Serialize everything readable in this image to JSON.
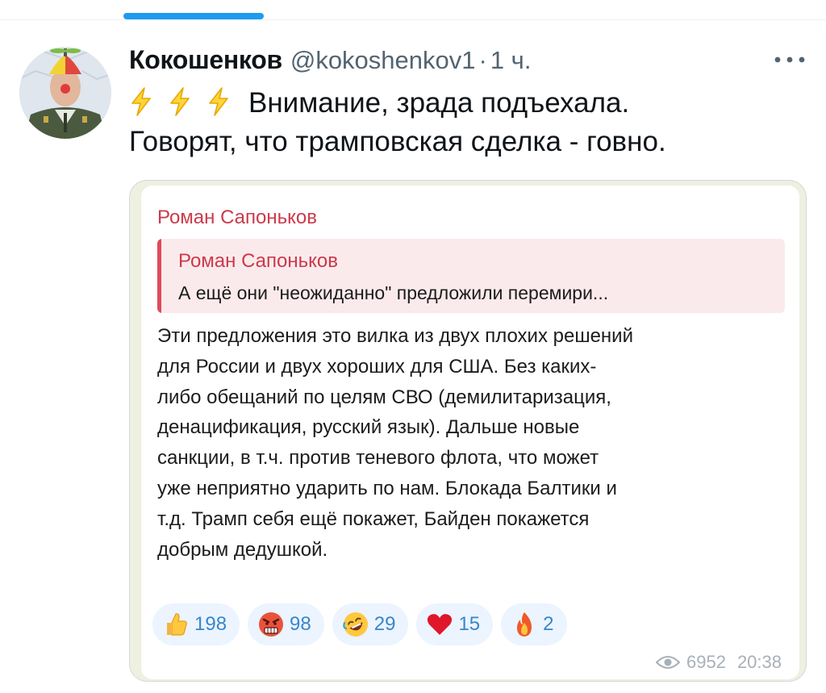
{
  "tweet": {
    "author_name": "Кокошенков",
    "author_handle": "@kokoshenkov1",
    "separator": "·",
    "time": "1 ч.",
    "text_line1": "Внимание, зрада подъехала.",
    "text_line2": "Говорят, что трамповская сделка - говно.",
    "emoji_icons": [
      "lightning-icon",
      "lightning-icon",
      "lightning-icon"
    ]
  },
  "quoted_post": {
    "channel_name": "Роман Сапоньков",
    "reply_to": {
      "name": "Роман Сапоньков",
      "text": "А ещё они \"неожиданно\" предложили перемири..."
    },
    "body_lines": [
      "Эти предложения это вилка из двух плохих решений",
      "для России и двух хороших для США.  Без каких-",
      "либо обещаний по целям СВО (демилитаризация,",
      "денацификация, русский язык). Дальше новые",
      "санкции, в т.ч. против теневого флота, что может",
      "уже неприятно ударить по нам. Блокада Балтики и",
      "т.д. Трамп себя ещё покажет, Байден покажется",
      "добрым дедушкой."
    ],
    "reactions": [
      {
        "icon": "thumbs-up-icon",
        "count": "198"
      },
      {
        "icon": "angry-face-icon",
        "count": "98"
      },
      {
        "icon": "rofl-face-icon",
        "count": "29"
      },
      {
        "icon": "heart-icon",
        "count": "15"
      },
      {
        "icon": "fire-icon",
        "count": "2"
      }
    ],
    "views": "6952",
    "time": "20:38"
  },
  "colors": {
    "accent": "#1d9bf0",
    "channel_name": "#cb3a4b",
    "reaction_count": "#3a86c8",
    "reaction_bg": "#ebf4ff"
  }
}
